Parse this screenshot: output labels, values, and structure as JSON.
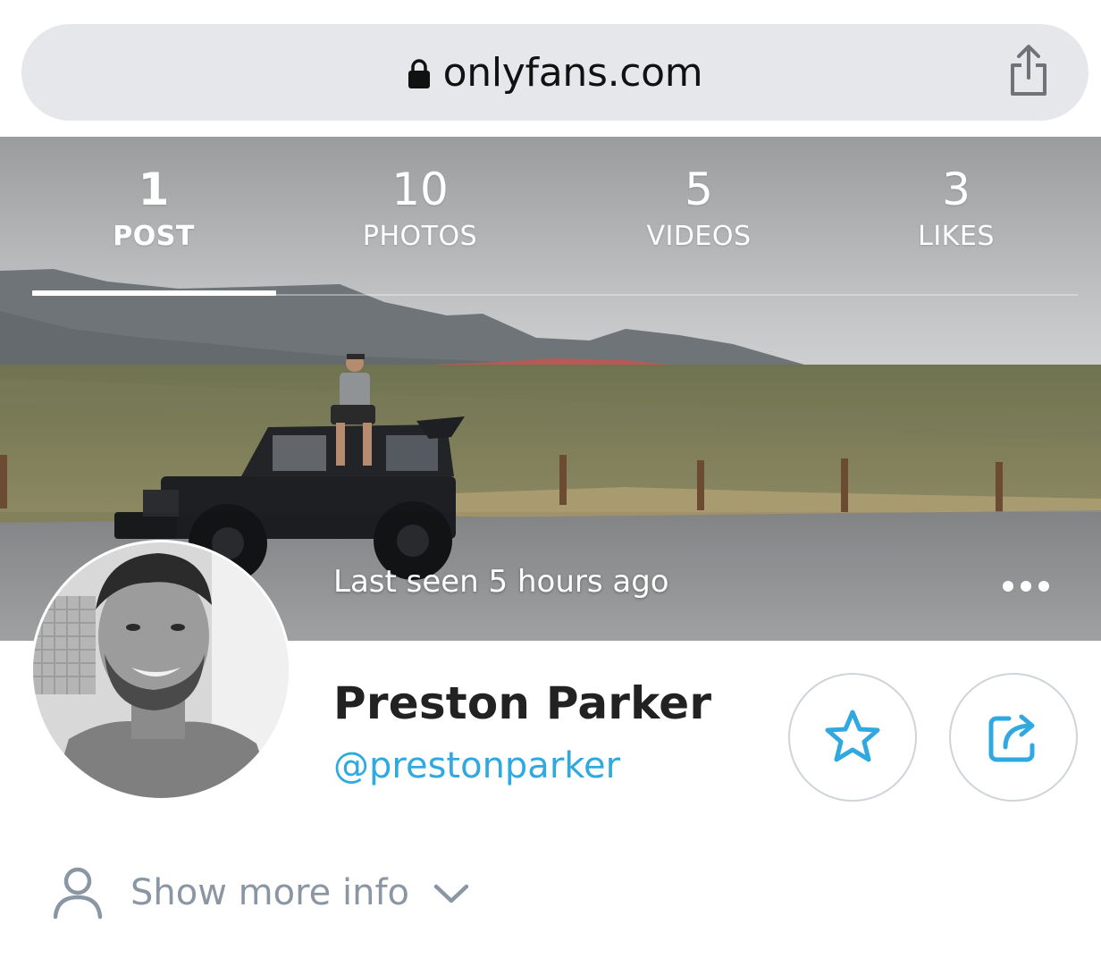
{
  "browser": {
    "url": "onlyfans.com",
    "lock_icon": "lock-icon",
    "share_icon": "share-icon"
  },
  "cover": {
    "stats": [
      {
        "count": "1",
        "label": "POST",
        "active": true
      },
      {
        "count": "10",
        "label": "PHOTOS",
        "active": false
      },
      {
        "count": "5",
        "label": "VIDEOS",
        "active": false
      },
      {
        "count": "3",
        "label": "LIKES",
        "active": false
      }
    ],
    "last_seen": "Last seen 5 hours ago",
    "more_icon": "more-dots-icon"
  },
  "profile": {
    "name": "Preston Parker",
    "handle": "@prestonparker",
    "favorite_icon": "star-icon",
    "share_icon": "share-profile-icon"
  },
  "show_more": {
    "label": "Show more info",
    "icon": "user-icon",
    "chevron": "chevron-down-icon"
  },
  "colors": {
    "accent": "#2fa9e0",
    "muted_text": "#8a96a3",
    "url_bar_bg": "#e6e7eb"
  }
}
